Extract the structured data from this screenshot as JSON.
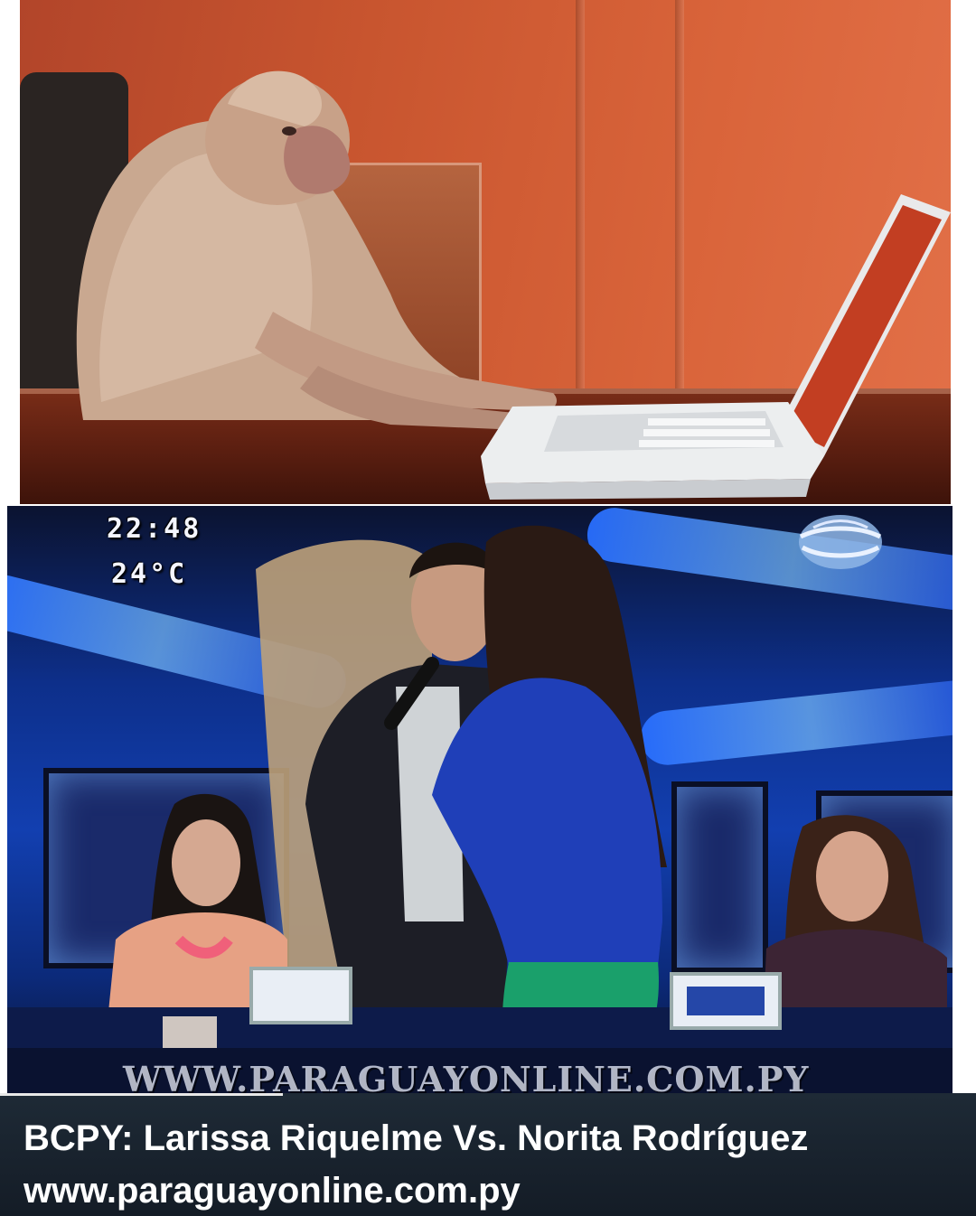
{
  "tv_overlay": {
    "time": "22:48",
    "temperature": "24°C",
    "watermark": "WWW.PARAGUAYONLINE.COM.PY"
  },
  "caption": {
    "title": "BCPY: Larissa Riquelme Vs. Norita Rodríguez",
    "url": "www.paraguayonline.com.py"
  },
  "video": {
    "progress": 0.29
  },
  "colors": {
    "wall": "#c8552f",
    "studio_blue": "#123fb0",
    "caption_bg": "#1e2a36"
  }
}
